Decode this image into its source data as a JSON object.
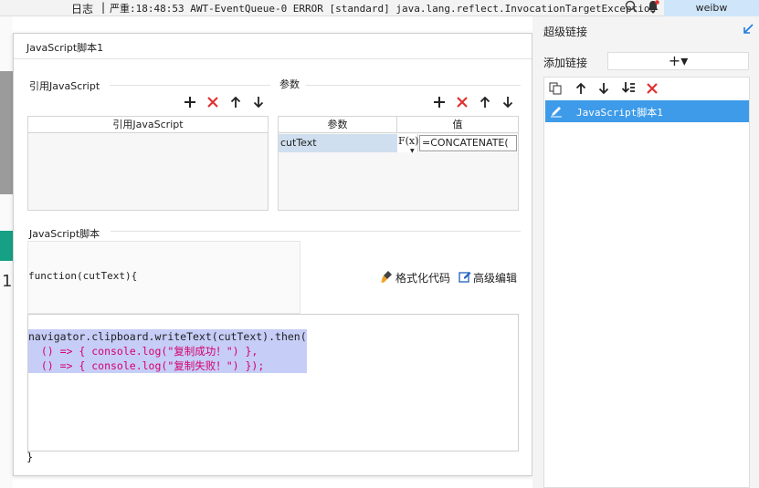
{
  "topbar": {
    "log_label": "日志",
    "separator": "|",
    "message": "严重:18:48:53 AWT-EventQueue-0 ERROR [standard] java.lang.reflect.InvocationTargetException",
    "search_icon": "magnifier-icon",
    "bell_icon": "bell-icon",
    "user": "weibw"
  },
  "background": {
    "row_number": "1"
  },
  "dialog": {
    "title": "JavaScript脚本1",
    "ref_js": {
      "section_label": "引用JavaScript",
      "column_header": "引用JavaScript"
    },
    "params": {
      "section_label": "参数",
      "columns": [
        "参数",
        "值"
      ],
      "rows": [
        {
          "name": "cutText",
          "formula_icon": "F(x)",
          "value": "=CONCATENATE("
        }
      ]
    },
    "script": {
      "section_label": "JavaScript脚本",
      "function_signature": "function(cutText){",
      "format_code": "格式化代码",
      "advanced_edit": "高级编辑",
      "code_line1": "navigator.clipboard.writeText(cutText).then(",
      "code_line2": "  () => { console.log(\"复制成功！\") },",
      "code_line3": "  () => { console.log(\"复制失败！\") });",
      "closing_brace": "}"
    }
  },
  "right_panel": {
    "title": "超级链接",
    "add_label": "添加链接",
    "add_button": "+▾",
    "items": [
      {
        "label": "JavaScript脚本1"
      }
    ]
  },
  "colors": {
    "selected_item": "#3d9be9",
    "delete_red": "#e03131",
    "code_selection": "#c6cdf7",
    "teal": "#16a085"
  }
}
